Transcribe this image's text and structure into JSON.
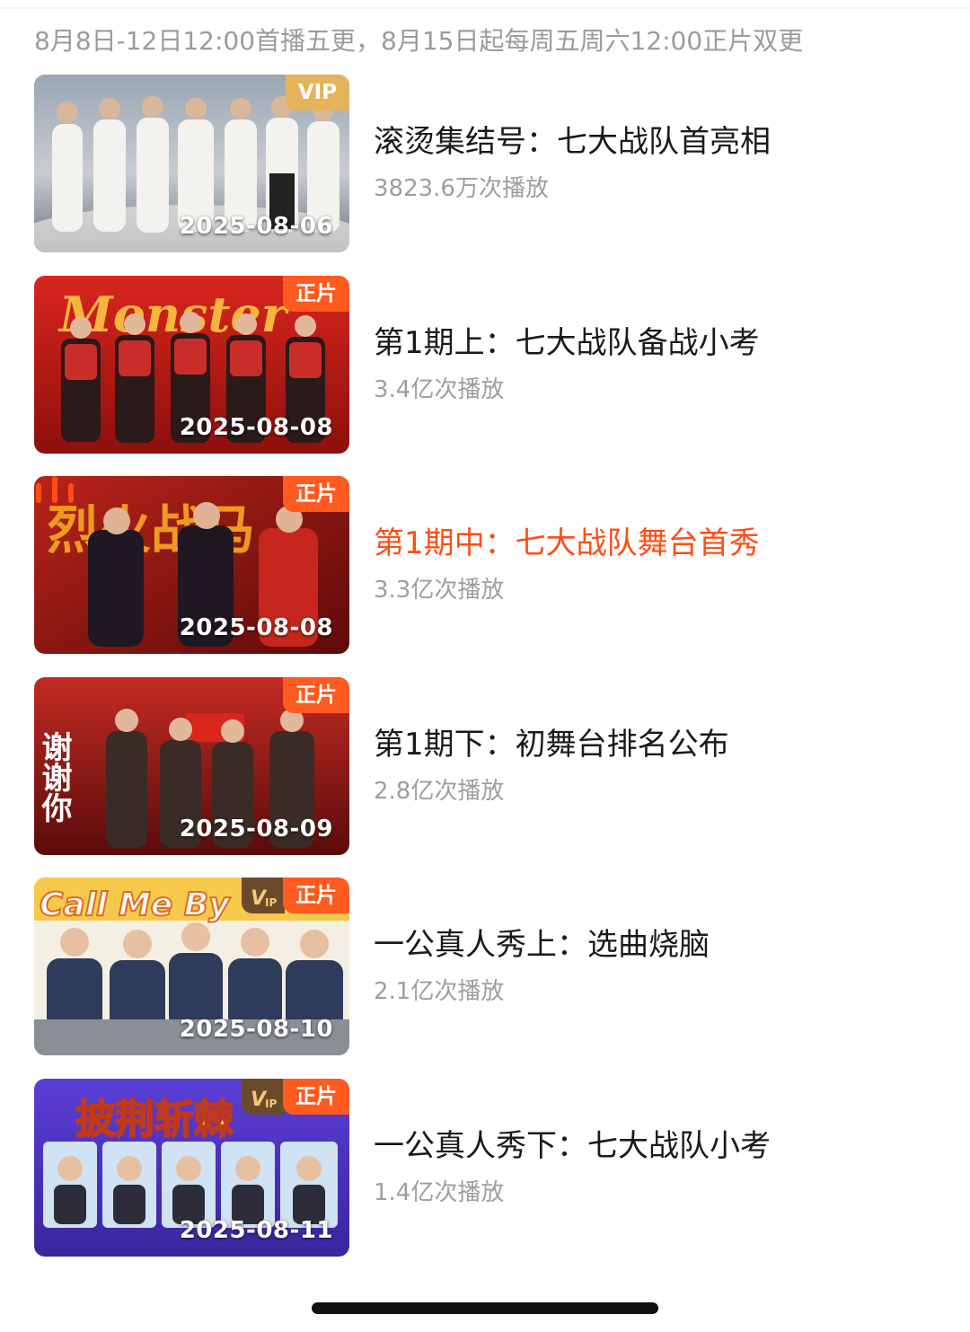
{
  "schedule_text": "8月8日-12日12:00首播五更，8月15日起每周五周六12:00正片双更",
  "colors": {
    "active_title": "#ff4d14",
    "badge_zhengpian": "#ff5a1f",
    "badge_vip": "#e4b35b"
  },
  "episodes": [
    {
      "title": "滚烫集结号：七大战队首亮相",
      "plays": "3823.6万次播放",
      "date": "2025-08-06",
      "badge": "VIP",
      "vip_icon": false,
      "playing": false,
      "thumb_text": ""
    },
    {
      "title": "第1期上：七大战队备战小考",
      "plays": "3.4亿次播放",
      "date": "2025-08-08",
      "badge": "正片",
      "vip_icon": false,
      "playing": false,
      "thumb_text": "Monster"
    },
    {
      "title": "第1期中：七大战队舞台首秀",
      "plays": "3.3亿次播放",
      "date": "2025-08-08",
      "badge": "正片",
      "vip_icon": false,
      "playing": true,
      "thumb_text": "烈火战马"
    },
    {
      "title": "第1期下：初舞台排名公布",
      "plays": "2.8亿次播放",
      "date": "2025-08-09",
      "badge": "正片",
      "vip_icon": false,
      "playing": false,
      "thumb_text": "谢谢你"
    },
    {
      "title": "一公真人秀上：选曲烧脑",
      "plays": "2.1亿次播放",
      "date": "2025-08-10",
      "badge": "正片",
      "vip_icon": true,
      "playing": false,
      "thumb_text": "Call Me By"
    },
    {
      "title": "一公真人秀下：七大战队小考",
      "plays": "1.4亿次播放",
      "date": "2025-08-11",
      "badge": "正片",
      "vip_icon": true,
      "playing": false,
      "thumb_text": "披荆斩棘"
    }
  ]
}
